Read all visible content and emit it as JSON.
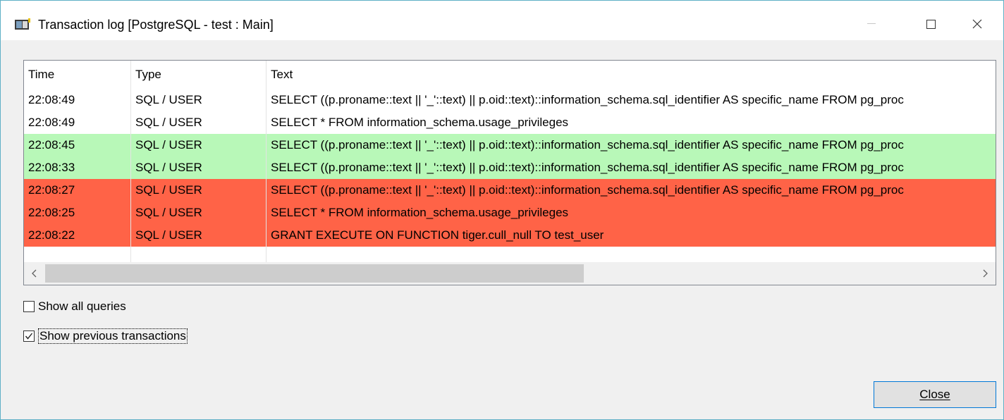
{
  "window": {
    "title": "Transaction log [PostgreSQL - test : Main]"
  },
  "table": {
    "columns": [
      "Time",
      "Type",
      "Text"
    ],
    "rows": [
      {
        "time": "22:08:49",
        "type": "SQL / USER",
        "text": "SELECT ((p.proname::text || '_'::text) || p.oid::text)::information_schema.sql_identifier AS specific_name FROM pg_proc",
        "status": "normal"
      },
      {
        "time": "22:08:49",
        "type": "SQL / USER",
        "text": "SELECT * FROM information_schema.usage_privileges",
        "status": "normal"
      },
      {
        "time": "22:08:45",
        "type": "SQL / USER",
        "text": "SELECT ((p.proname::text || '_'::text) || p.oid::text)::information_schema.sql_identifier AS specific_name FROM pg_proc",
        "status": "committed"
      },
      {
        "time": "22:08:33",
        "type": "SQL / USER",
        "text": "SELECT ((p.proname::text || '_'::text) || p.oid::text)::information_schema.sql_identifier AS specific_name FROM pg_proc",
        "status": "committed"
      },
      {
        "time": "22:08:27",
        "type": "SQL / USER",
        "text": "SELECT ((p.proname::text || '_'::text) || p.oid::text)::information_schema.sql_identifier AS specific_name FROM pg_proc",
        "status": "rolled_back"
      },
      {
        "time": "22:08:25",
        "type": "SQL / USER",
        "text": "SELECT * FROM information_schema.usage_privileges",
        "status": "rolled_back"
      },
      {
        "time": "22:08:22",
        "type": "SQL / USER",
        "text": "GRANT EXECUTE ON FUNCTION tiger.cull_null TO test_user",
        "status": "rolled_back"
      }
    ],
    "status_colors": {
      "normal": "#ffffff",
      "committed": "#b8f8b8",
      "rolled_back": "#ff6347"
    }
  },
  "scrollbar": {
    "left_icon": "chevron-left-icon",
    "right_icon": "chevron-right-icon"
  },
  "options": {
    "show_all_queries": {
      "label": "Show all queries",
      "checked": false
    },
    "show_previous_transactions": {
      "label": "Show previous transactions",
      "checked": true
    }
  },
  "buttons": {
    "close_label": "Close"
  },
  "icons": {
    "app": "transaction-log-app-icon",
    "minimize": "minimize-icon",
    "maximize": "maximize-icon",
    "close": "close-icon"
  }
}
